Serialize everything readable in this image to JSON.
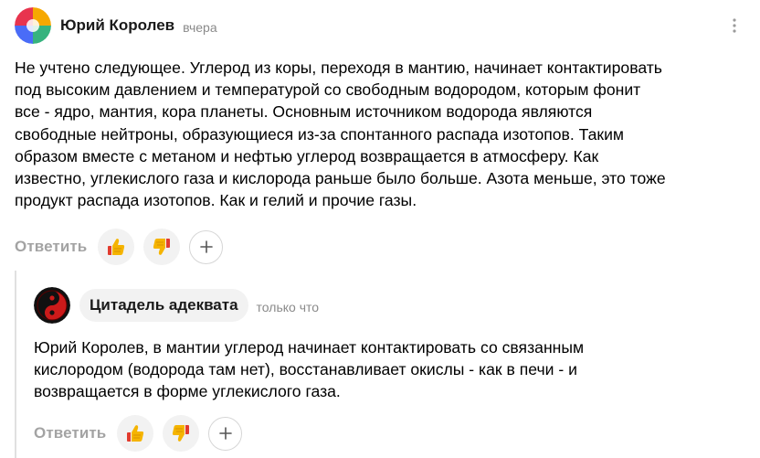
{
  "comments": [
    {
      "author": "Юрий Королев",
      "time": "вчера",
      "text": "Не учтено следующее. Углерод из коры, переходя в мантию, начинает контактировать\nпод высоким давлением и температурой со свободным водородом, которым фонит\nвсе - ядро, мантия, кора планеты. Основным источником водорода являются\nсвободные нейтроны, образующиеся из-за спонтанного распада изотопов. Таким\nобразом вместе с метаном и нефтью углерод возвращается в атмосферу. Как\nизвестно, углекислого газа и кислорода раньше было больше. Азота меньше, это тоже\nпродукт распада изотопов. Как и гелий и прочие газы.",
      "reply_label": "Ответить",
      "avatar_icon": "colorful-quadrant-avatar",
      "like_icon": "thumbs-up-icon",
      "dislike_icon": "thumbs-down-icon",
      "add_reaction_icon": "plus-icon",
      "menu_icon": "vertical-dots-icon"
    },
    {
      "author": "Цитадель адеквата",
      "time": "только что",
      "text": "Юрий Королев, в мантии углерод начинает контактировать со связанным\nкислородом (водорода там нет), восстанавливает окислы - как в печи - и\nвозвращается в форме углекислого газа.",
      "reply_label": "Ответить",
      "avatar_icon": "yin-yang-red-avatar",
      "like_icon": "thumbs-up-icon",
      "dislike_icon": "thumbs-down-icon",
      "add_reaction_icon": "plus-icon"
    }
  ],
  "colors": {
    "muted_text": "#a3a3a3",
    "time_text": "#8a8a8a",
    "pill_bg": "#f2f2f2",
    "thread_line": "#e0e0e0",
    "reaction_yellow": "#f5b400",
    "reaction_red": "#e23b2e"
  }
}
